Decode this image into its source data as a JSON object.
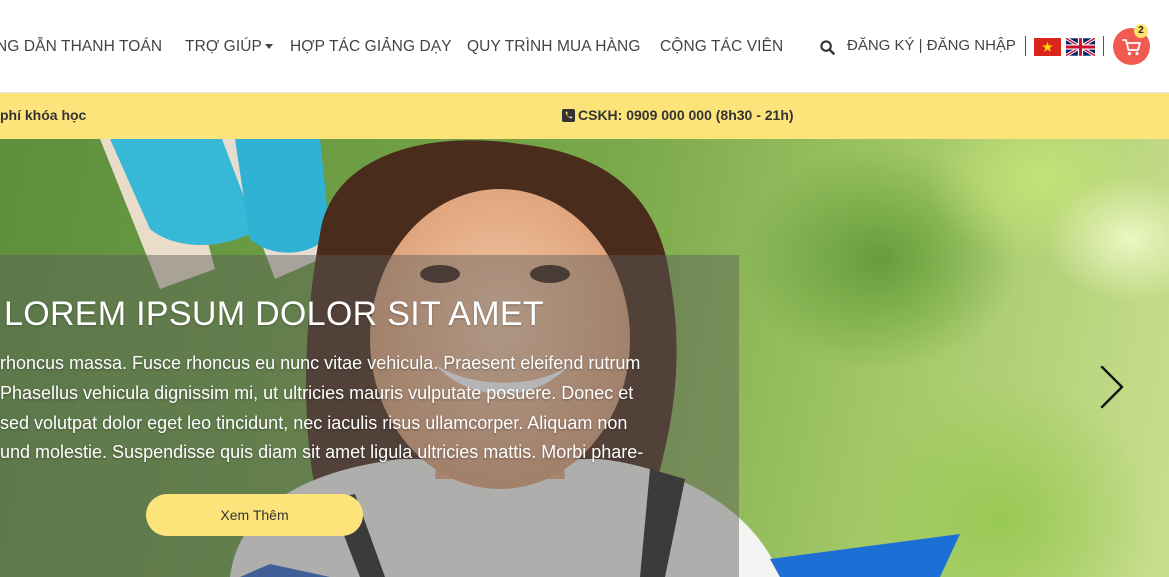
{
  "nav": {
    "items": [
      {
        "label": "NG DẪN THANH TOÁN"
      },
      {
        "label": "TRỢ GIÚP",
        "has_dropdown": true
      },
      {
        "label": "HỢP TÁC GIẢNG DẠY"
      },
      {
        "label": "QUY TRÌNH MUA HÀNG"
      },
      {
        "label": "CỘNG TÁC VIÊN"
      }
    ],
    "search_icon": "search-icon",
    "register_label": "ĐĂNG KÝ",
    "auth_separator": " | ",
    "login_label": "ĐĂNG NHẬP",
    "flags": [
      "vietnam-flag-icon",
      "uk-flag-icon"
    ],
    "cart_icon": "shopping-cart-icon",
    "cart_count": "2",
    "accent_color": "#f05a51"
  },
  "info_bar": {
    "left_text": "phí khóa học",
    "phone_icon": "phone-icon",
    "support_text": "CSKH: 0909 000 000 (8h30 - 21h)",
    "background": "#fde47a"
  },
  "hero": {
    "title": "LOREM IPSUM DOLOR SIT AMET",
    "lines": [
      "rhoncus massa. Fusce rhoncus eu nunc vitae vehicula. Praesent eleifend rutrum",
      "Phasellus vehicula dignissim mi, ut ultricies mauris vulputate posuere. Donec et",
      "sed volutpat dolor eget leo tincidunt, nec iaculis risus ullamcorper. Aliquam non",
      "und molestie. Suspendisse quis diam sit amet ligula ultricies mattis. Morbi phare-"
    ],
    "button_label": "Xem Thêm",
    "next_icon": "chevron-right-icon"
  }
}
